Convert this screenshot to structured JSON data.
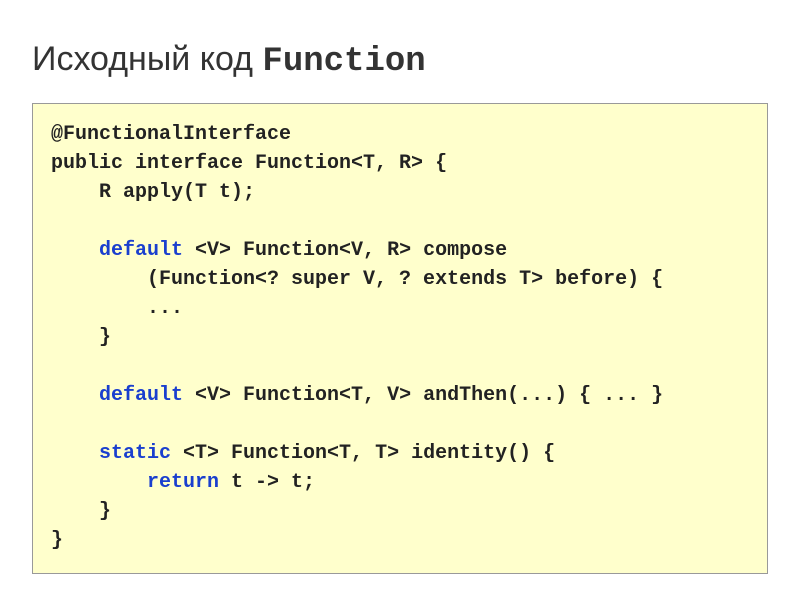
{
  "title": {
    "prefix": "Исходный код ",
    "class_name": "Function"
  },
  "code": {
    "l1": "@FunctionalInterface",
    "l2": "public interface Function<T, R> {",
    "l3": "    R apply(T t);",
    "l4": "",
    "l5_kw": "    default",
    "l5_rest": " <V> Function<V, R> compose",
    "l6": "        (Function<? super V, ? extends T> before) {",
    "l7": "        ...",
    "l8": "    }",
    "l9": "",
    "l10_kw": "    default",
    "l10_rest": " <V> Function<T, V> andThen(...) { ... }",
    "l11": "",
    "l12_kw": "    static",
    "l12_rest": " <T> Function<T, T> identity() {",
    "l13_kw": "        return",
    "l13_rest": " t -> t;",
    "l14": "    }",
    "l15": "}"
  }
}
